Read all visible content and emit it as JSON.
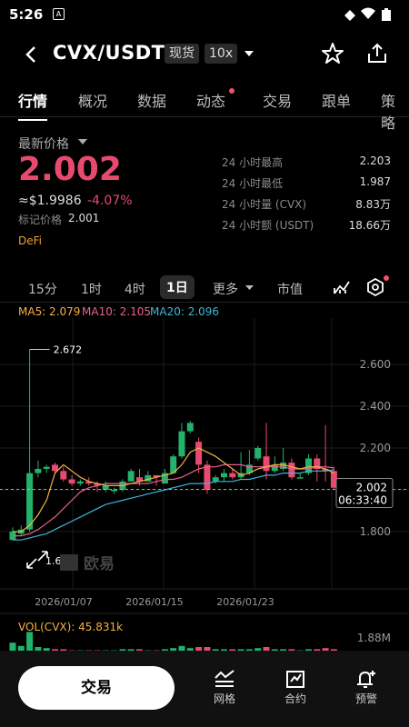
{
  "status": {
    "time": "5:26"
  },
  "header": {
    "pair": "CVX/USDT",
    "market_type": "现货",
    "leverage": "10x"
  },
  "tabs": [
    {
      "label": "行情",
      "active": true
    },
    {
      "label": "概况"
    },
    {
      "label": "数据"
    },
    {
      "label": "动态",
      "dot": true
    },
    {
      "label": "交易"
    },
    {
      "label": "跟单"
    },
    {
      "label": "策略"
    }
  ],
  "price": {
    "label": "最新价格",
    "last": "2.002",
    "usd": "≈$1.9986",
    "change": "-4.07%",
    "mark_label": "标记价格",
    "mark": "2.001",
    "tag": "DeFi"
  },
  "stats": [
    {
      "k": "24 小时最高",
      "v": "2.203"
    },
    {
      "k": "24 小时最低",
      "v": "1.987"
    },
    {
      "k": "24 小时量 (CVX)",
      "v": "8.83万"
    },
    {
      "k": "24 小时额 (USDT)",
      "v": "18.66万"
    }
  ],
  "timeframes": {
    "m15": "15分",
    "h1": "1时",
    "h4": "4时",
    "d1": "1日",
    "more": "更多",
    "mcap": "市值"
  },
  "ma": {
    "ma5": "MA5: 2.079",
    "ma10": "MA10: 2.105",
    "ma20": "MA20: 2.096"
  },
  "chart_data": {
    "type": "candlestick",
    "y_ticks": [
      "2.600",
      "2.400",
      "2.200",
      "1.800"
    ],
    "x_ticks": [
      "2026/01/07",
      "2026/01/15",
      "2026/01/23"
    ],
    "max_label": "2.672",
    "min_label": "1.679",
    "current_price": "2.002",
    "countdown": "06:33:40",
    "volume_label": "VOL(CVX): 45.831k",
    "volume_axis": "1.88M",
    "watermark": "欧易",
    "candles": [
      [
        1.76,
        1.8,
        1.76,
        1.82
      ],
      [
        1.79,
        1.81,
        1.78,
        1.83
      ],
      [
        1.81,
        2.08,
        1.8,
        2.672
      ],
      [
        2.08,
        2.1,
        2.06,
        2.14
      ],
      [
        2.1,
        2.11,
        2.08,
        2.12
      ],
      [
        2.12,
        2.09,
        2.08,
        2.13
      ],
      [
        2.09,
        2.05,
        2.04,
        2.11
      ],
      [
        2.05,
        2.03,
        2.02,
        2.07
      ],
      [
        2.03,
        2.04,
        2.02,
        2.05
      ],
      [
        2.04,
        2.03,
        2.02,
        2.06
      ],
      [
        2.03,
        2.02,
        1.99,
        2.04
      ],
      [
        2.0,
        2.02,
        1.99,
        2.04
      ],
      [
        2.0,
        2.0,
        1.98,
        2.01
      ],
      [
        2.0,
        2.04,
        1.99,
        2.05
      ],
      [
        2.04,
        2.09,
        2.04,
        2.1
      ],
      [
        2.06,
        2.04,
        2.02,
        2.1
      ],
      [
        2.04,
        2.07,
        2.04,
        2.09
      ],
      [
        2.07,
        2.06,
        2.02,
        2.07
      ],
      [
        2.03,
        2.08,
        2.03,
        2.1
      ],
      [
        2.08,
        2.16,
        2.08,
        2.17
      ],
      [
        2.16,
        2.28,
        2.15,
        2.32
      ],
      [
        2.28,
        2.32,
        2.27,
        2.33
      ],
      [
        2.23,
        2.12,
        2.08,
        2.25
      ],
      [
        2.12,
        2.0,
        1.98,
        2.14
      ],
      [
        2.04,
        2.06,
        2.03,
        2.07
      ],
      [
        2.06,
        2.08,
        2.04,
        2.1
      ],
      [
        2.08,
        2.06,
        2.05,
        2.1
      ],
      [
        2.06,
        2.08,
        2.05,
        2.18
      ],
      [
        2.08,
        2.12,
        2.07,
        2.19
      ],
      [
        2.15,
        2.2,
        2.14,
        2.21
      ],
      [
        2.16,
        2.09,
        2.05,
        2.32
      ],
      [
        2.09,
        2.12,
        2.08,
        2.16
      ],
      [
        2.1,
        2.13,
        2.09,
        2.2
      ],
      [
        2.13,
        2.06,
        2.05,
        2.15
      ],
      [
        2.06,
        2.06,
        2.06,
        2.08
      ],
      [
        2.08,
        2.15,
        2.07,
        2.17
      ],
      [
        2.15,
        2.1,
        2.04,
        2.17
      ],
      [
        2.1,
        2.09,
        2.04,
        2.31
      ],
      [
        2.09,
        2.01,
        2.0,
        2.11
      ]
    ],
    "ma5": [
      1.8,
      1.8,
      1.83,
      1.88,
      1.95,
      2.08,
      2.12,
      2.09,
      2.06,
      2.04,
      2.03,
      2.02,
      2.02,
      2.02,
      2.03,
      2.04,
      2.05,
      2.06,
      2.07,
      2.08,
      2.12,
      2.18,
      2.2,
      2.18,
      2.16,
      2.13,
      2.1,
      2.07,
      2.08,
      2.1,
      2.11,
      2.12,
      2.12,
      2.11,
      2.1,
      2.11,
      2.11,
      2.1,
      2.08
    ],
    "ma10": [
      1.78,
      1.78,
      1.79,
      1.81,
      1.84,
      1.87,
      1.91,
      1.95,
      1.99,
      2.01,
      2.02,
      2.03,
      2.03,
      2.03,
      2.03,
      2.03,
      2.03,
      2.04,
      2.05,
      2.05,
      2.06,
      2.08,
      2.1,
      2.11,
      2.11,
      2.12,
      2.12,
      2.12,
      2.11,
      2.11,
      2.11,
      2.11,
      2.11,
      2.1,
      2.1,
      2.1,
      2.11,
      2.11,
      2.105
    ],
    "ma20": [
      1.76,
      1.76,
      1.77,
      1.78,
      1.79,
      1.81,
      1.83,
      1.85,
      1.87,
      1.89,
      1.91,
      1.93,
      1.94,
      1.95,
      1.96,
      1.97,
      1.98,
      1.99,
      2.0,
      2.01,
      2.02,
      2.03,
      2.03,
      2.03,
      2.04,
      2.04,
      2.04,
      2.05,
      2.05,
      2.06,
      2.07,
      2.07,
      2.08,
      2.08,
      2.08,
      2.09,
      2.09,
      2.09,
      2.096
    ],
    "volumes": [
      0.9,
      0.6,
      1.88,
      0.5,
      0.4,
      0.3,
      0.3,
      0.2,
      0.2,
      0.2,
      0.2,
      0.2,
      0.2,
      0.3,
      0.3,
      0.3,
      0.2,
      0.2,
      0.3,
      0.4,
      0.6,
      0.4,
      0.5,
      0.5,
      0.3,
      0.3,
      0.3,
      0.3,
      0.3,
      0.4,
      0.5,
      0.3,
      0.3,
      0.3,
      0.2,
      0.3,
      0.3,
      0.4,
      0.3
    ],
    "colors": {
      "up": "#23b26b",
      "down": "#e84a6f",
      "ma5": "#f5b041",
      "ma10": "#e8618c",
      "ma20": "#3fb6d8"
    }
  },
  "bottom": {
    "trade": "交易",
    "grid": "网格",
    "contract": "合约",
    "alert": "预警"
  }
}
